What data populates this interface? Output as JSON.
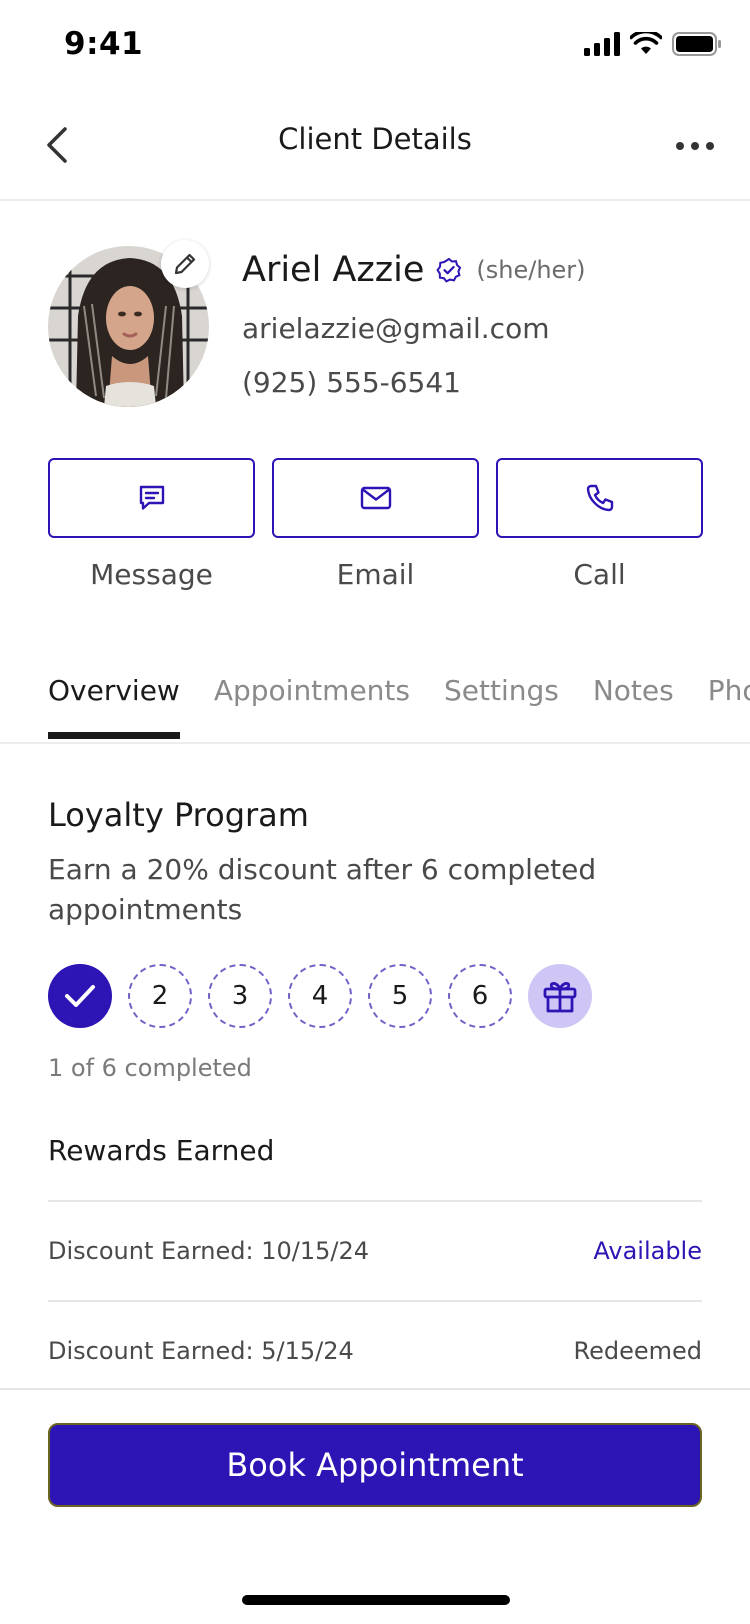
{
  "status_bar": {
    "time": "9:41"
  },
  "header": {
    "title": "Client Details"
  },
  "client": {
    "name": "Ariel Azzie",
    "pronouns": "(she/her)",
    "email": "arielazzie@gmail.com",
    "phone": "(925) 555-6541"
  },
  "actions": [
    {
      "label": "Message",
      "icon": "message-icon"
    },
    {
      "label": "Email",
      "icon": "mail-icon"
    },
    {
      "label": "Call",
      "icon": "phone-icon"
    }
  ],
  "tabs": [
    {
      "label": "Overview",
      "active": true
    },
    {
      "label": "Appointments"
    },
    {
      "label": "Settings"
    },
    {
      "label": "Notes"
    },
    {
      "label": "Photos"
    }
  ],
  "loyalty": {
    "title": "Loyalty Program",
    "description": "Earn a 20% discount after 6 completed appointments",
    "steps": [
      "2",
      "3",
      "4",
      "5",
      "6"
    ],
    "completed": 1,
    "total": 6,
    "progress_text": "1 of 6 completed"
  },
  "rewards": {
    "title": "Rewards Earned",
    "items": [
      {
        "label": "Discount Earned: 10/15/24",
        "status": "Available"
      },
      {
        "label": "Discount Earned: 5/15/24",
        "status": "Redeemed"
      }
    ]
  },
  "cta": {
    "label": "Book Appointment"
  },
  "colors": {
    "accent": "#2d14b5",
    "reward_bg": "#cfc6f5"
  }
}
